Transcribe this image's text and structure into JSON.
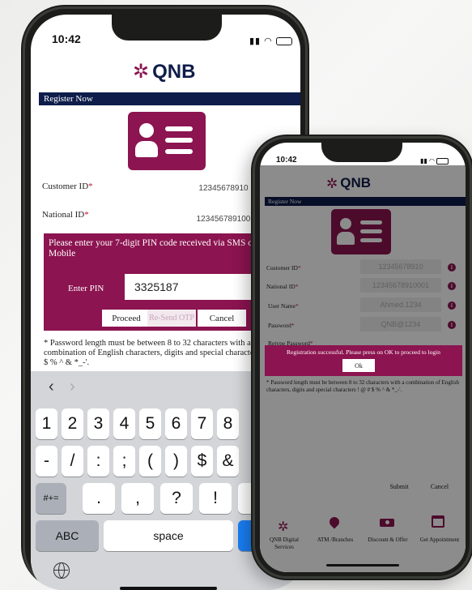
{
  "back_phone": {
    "status_time": "10:42",
    "brand": "QNB",
    "register_title": "Register Now",
    "customer_id_label": "Customer ID",
    "customer_id_value": "12345678910",
    "national_id_label": "National ID",
    "national_id_value": "123456789100",
    "pin_message": "Please enter your 7-digit PIN code received via SMS on your Mobile",
    "enter_pin_label": "Enter PIN",
    "pin_value": "3325187",
    "proceed_label": "Proceed",
    "resend_label": "Re-Send OTP",
    "cancel_label": "Cancel",
    "password_note": "* Password length must be between 8 to 32 characters with a combination of English characters, digits and special characters ! @ # $ % ^ & *_-'.",
    "keyboard": {
      "row1": [
        "1",
        "2",
        "3",
        "4",
        "5",
        "6",
        "7",
        "8"
      ],
      "row2": [
        "-",
        "/",
        ":",
        ";",
        "(",
        ")",
        "$",
        "&"
      ],
      "row3": [
        "#+=",
        ".",
        ",",
        "?",
        "!",
        "'"
      ],
      "abc_label": "ABC",
      "space_label": "space"
    }
  },
  "front_phone": {
    "status_time": "10:42",
    "brand": "QNB",
    "register_title": "Register Now",
    "customer_id_label": "Customer ID",
    "customer_id_value": "12345678910",
    "national_id_label": "National ID",
    "national_id_value": "12345678910001",
    "user_name_label": "User Name",
    "user_name_value": "Ahmed.1234",
    "password_label": "Password",
    "password_value": "QNB@1234",
    "retype_password_label": "Retype Password",
    "success_message": "Registration successful. Please press on OK to proceed to login",
    "ok_label": "Ok",
    "password_note": "* Password length must be between 8 to 32 characters with a combination of English characters, digits and special characters ! @ # $ % ^ & *_-'.",
    "submit_label": "Submit",
    "cancel_label": "Cancel",
    "nav": {
      "digital": "QNB Digital Services",
      "atm": "ATM /Branches",
      "offers": "Discount & Offer",
      "appointment": "Get Appointment"
    }
  },
  "colors": {
    "brand_maroon": "#8c1450",
    "header_navy": "#0e1d4a"
  }
}
